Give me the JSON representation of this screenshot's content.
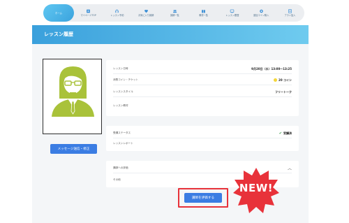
{
  "nav": {
    "items": [
      {
        "label": "ホーム",
        "icon": "home-icon",
        "active": true
      },
      {
        "label": "マイページTOP",
        "icon": "mypage-icon"
      },
      {
        "label": "レッスン予約",
        "icon": "headset-icon"
      },
      {
        "label": "お気に入り講師",
        "icon": "heart-icon"
      },
      {
        "label": "講師一覧",
        "icon": "people-icon"
      },
      {
        "label": "教材一覧",
        "icon": "book-icon"
      },
      {
        "label": "レッスン履歴",
        "icon": "history-icon"
      },
      {
        "label": "追加コイン購入",
        "icon": "coin-icon"
      },
      {
        "label": "プラン加入",
        "icon": "plan-icon"
      }
    ]
  },
  "header": {
    "title": "レッスン履歴"
  },
  "avatar": {
    "icon": "teacher-avatar-icon",
    "color": "#a9c23a"
  },
  "message_button": "メッセージ送信・修正",
  "lesson_card": {
    "rows": [
      {
        "label": "レッスン日時",
        "value": "9月20日（水）13:00～13:25"
      },
      {
        "label": "消費コイン・チケット",
        "value": "20 コイン"
      },
      {
        "label": "レッスンスタイル",
        "value": "フリートーク"
      },
      {
        "label": "レッスン教材",
        "value": ""
      }
    ]
  },
  "status_card": {
    "rows": [
      {
        "label": "受講ステータス",
        "value": "受講済"
      },
      {
        "label": "レッスンレポート",
        "value": ""
      }
    ]
  },
  "review_card": {
    "rows": [
      {
        "label": "講師への評価",
        "value": ""
      },
      {
        "label": "その他",
        "value": ""
      }
    ]
  },
  "evaluate_button": "講師を評価する",
  "badge": {
    "text": "NEW!",
    "color": "#e8323a"
  }
}
